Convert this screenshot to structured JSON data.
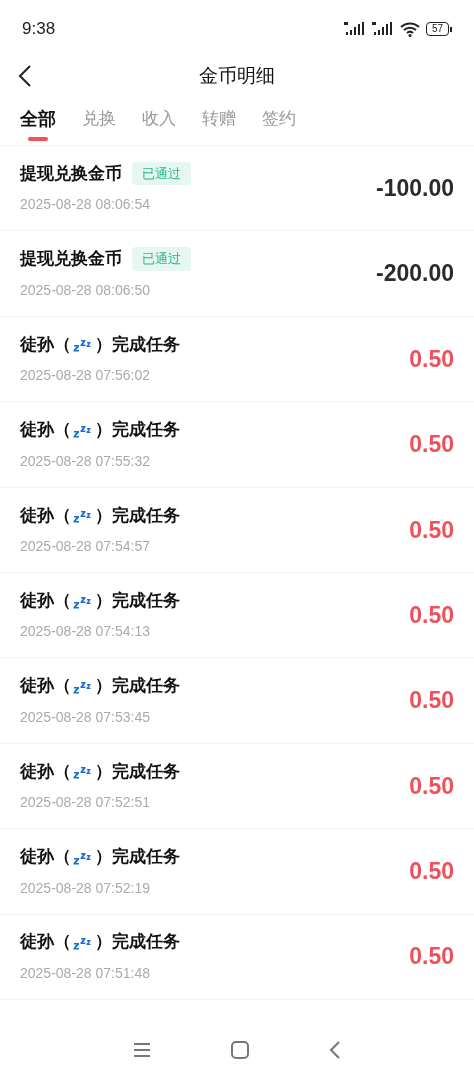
{
  "status_bar": {
    "time": "9:38",
    "battery": "57"
  },
  "header": {
    "title": "金币明细"
  },
  "tabs": [
    {
      "label": "全部",
      "selected": true
    },
    {
      "label": "兑换",
      "selected": false
    },
    {
      "label": "收入",
      "selected": false
    },
    {
      "label": "转赠",
      "selected": false
    },
    {
      "label": "签约",
      "selected": false
    }
  ],
  "records": [
    {
      "kind": "expense",
      "title": "提现兑换金币",
      "status": "已通过",
      "time": "2025-08-28 08:06:54",
      "amount": "-100.00"
    },
    {
      "kind": "expense",
      "title": "提现兑换金币",
      "status": "已通过",
      "time": "2025-08-28 08:06:50",
      "amount": "-200.00"
    },
    {
      "kind": "income",
      "title": "徒孙（",
      "title_end": "）完成任务",
      "time": "2025-08-28 07:56:02",
      "amount": "0.50"
    },
    {
      "kind": "income",
      "title": "徒孙（",
      "title_end": "）完成任务",
      "time": "2025-08-28 07:55:32",
      "amount": "0.50"
    },
    {
      "kind": "income",
      "title": "徒孙（",
      "title_end": "）完成任务",
      "time": "2025-08-28 07:54:57",
      "amount": "0.50"
    },
    {
      "kind": "income",
      "title": "徒孙（",
      "title_end": "）完成任务",
      "time": "2025-08-28 07:54:13",
      "amount": "0.50"
    },
    {
      "kind": "income",
      "title": "徒孙（",
      "title_end": "）完成任务",
      "time": "2025-08-28 07:53:45",
      "amount": "0.50"
    },
    {
      "kind": "income",
      "title": "徒孙（",
      "title_end": "）完成任务",
      "time": "2025-08-28 07:52:51",
      "amount": "0.50"
    },
    {
      "kind": "income",
      "title": "徒孙（",
      "title_end": "）完成任务",
      "time": "2025-08-28 07:52:19",
      "amount": "0.50"
    },
    {
      "kind": "income",
      "title": "徒孙（",
      "title_end": "）完成任务",
      "time": "2025-08-28 07:51:48",
      "amount": "0.50"
    }
  ]
}
